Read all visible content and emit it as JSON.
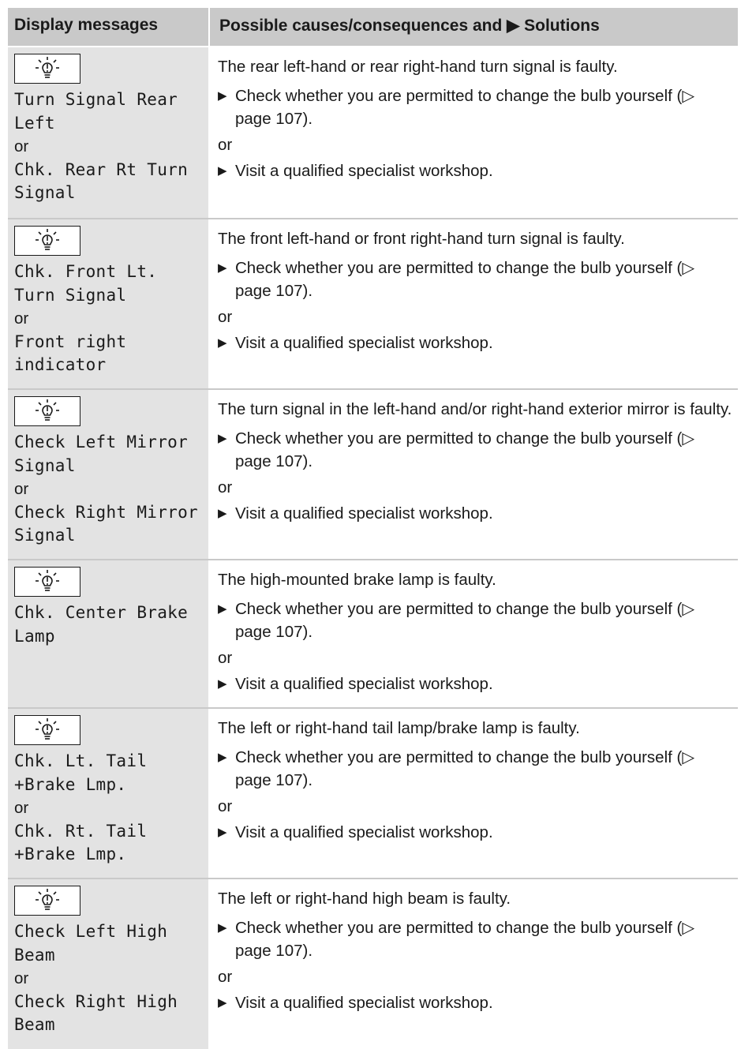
{
  "header": {
    "col1": "Display messages",
    "col2": "Possible causes/consequences and ▶ Solutions"
  },
  "rows": [
    {
      "msg1": "Turn Signal Rear\nLeft",
      "or": "or",
      "msg2": "Chk. Rear Rt Turn\nSignal",
      "cause": "The rear left-hand or rear right-hand turn signal is faulty.",
      "step1": "Check whether you are permitted to change the bulb yourself (▷ page 107).",
      "or2": "or",
      "step2": "Visit a qualified specialist workshop."
    },
    {
      "msg1": "Chk. Front Lt.\nTurn Signal",
      "or": "or",
      "msg2": "Front right\nindicator",
      "cause": "The front left-hand or front right-hand turn signal is faulty.",
      "step1": "Check whether you are permitted to change the bulb yourself (▷ page 107).",
      "or2": "or",
      "step2": "Visit a qualified specialist workshop."
    },
    {
      "msg1": "Check Left Mirror\nSignal",
      "or": "or",
      "msg2": "Check Right Mirror\nSignal",
      "cause": "The turn signal in the left-hand and/or right-hand exterior mirror is faulty.",
      "step1": "Check whether you are permitted to change the bulb yourself (▷ page 107).",
      "or2": "or",
      "step2": "Visit a qualified specialist workshop."
    },
    {
      "msg1": "Chk. Center Brake\nLamp",
      "or": "",
      "msg2": "",
      "cause": "The high-mounted brake lamp is faulty.",
      "step1": "Check whether you are permitted to change the bulb yourself (▷ page 107).",
      "or2": "or",
      "step2": "Visit a qualified specialist workshop."
    },
    {
      "msg1": "Chk. Lt. Tail\n+Brake Lmp.",
      "or": "or",
      "msg2": "Chk. Rt. Tail\n+Brake Lmp.",
      "cause": "The left or right-hand tail lamp/brake lamp is faulty.",
      "step1": "Check whether you are permitted to change the bulb yourself (▷ page 107).",
      "or2": "or",
      "step2": "Visit a qualified specialist workshop."
    },
    {
      "msg1": "Check Left High\nBeam",
      "or": "or",
      "msg2": "Check Right High\nBeam",
      "cause": "The left or right-hand high beam is faulty.",
      "step1": "Check whether you are permitted to change the bulb yourself (▷ page 107).",
      "or2": "or",
      "step2": "Visit a qualified specialist workshop."
    }
  ],
  "icons": {
    "lamp": "bulb-warning-icon",
    "step": "triangle-bullet-icon"
  },
  "colors": {
    "header_bg": "#c9c9c9",
    "left_bg": "#e3e3e3"
  }
}
